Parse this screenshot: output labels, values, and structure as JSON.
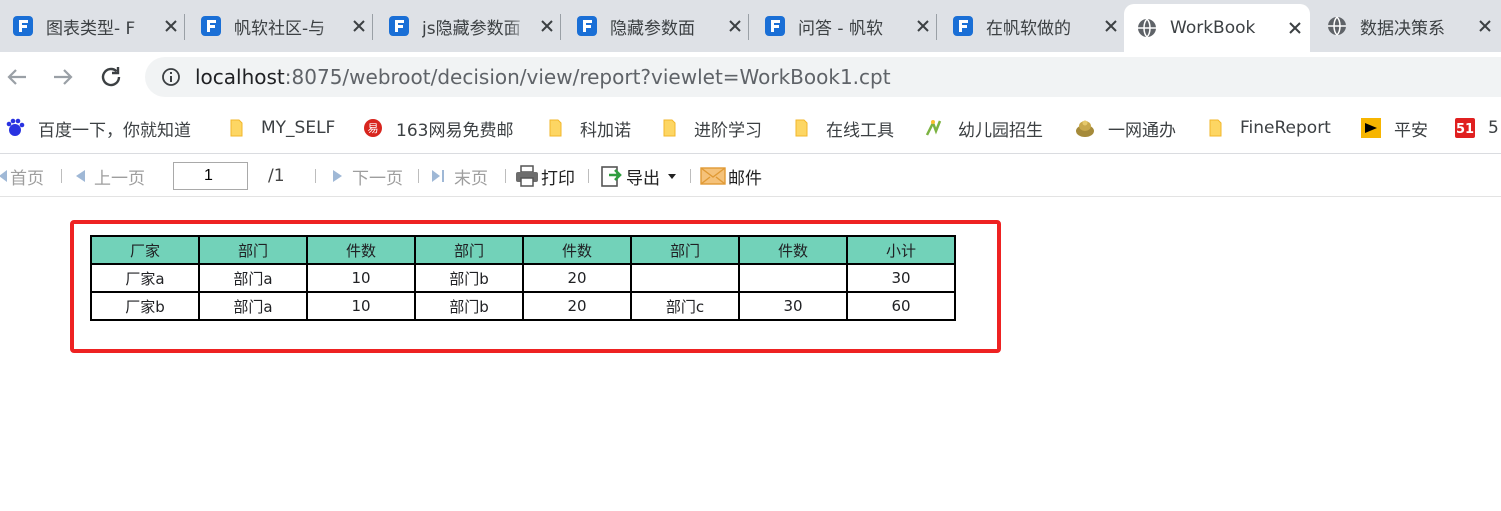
{
  "tabs": [
    {
      "title": "图表类型- F",
      "favicon": "finereport-icon"
    },
    {
      "title": "帆软社区-与",
      "favicon": "finereport-icon"
    },
    {
      "title": "js隐藏参数面",
      "favicon": "finereport-icon"
    },
    {
      "title": "隐藏参数面",
      "favicon": "finereport-icon"
    },
    {
      "title": "问答 - 帆软",
      "favicon": "finereport-icon"
    },
    {
      "title": "在帆软做的",
      "favicon": "finereport-icon"
    },
    {
      "title": "WorkBook",
      "favicon": "globe-icon",
      "active": true
    },
    {
      "title": "数据决策系",
      "favicon": "globe-icon"
    }
  ],
  "address": {
    "host": "localhost",
    "rest": ":8075/webroot/decision/view/report?viewlet=WorkBook1.cpt"
  },
  "bookmarks": [
    {
      "label": "百度一下，你就知道",
      "icon": "baidu-icon"
    },
    {
      "label": "MY_SELF",
      "icon": "folder-icon"
    },
    {
      "label": "163网易免费邮",
      "icon": "netease-icon"
    },
    {
      "label": "科加诺",
      "icon": "folder-icon"
    },
    {
      "label": "进阶学习",
      "icon": "folder-icon"
    },
    {
      "label": "在线工具",
      "icon": "folder-icon"
    },
    {
      "label": "幼儿园招生",
      "icon": "kindergarten-icon"
    },
    {
      "label": "一网通办",
      "icon": "gov-icon"
    },
    {
      "label": "FineReport",
      "icon": "folder-icon"
    },
    {
      "label": "平安",
      "icon": "pingan-icon"
    },
    {
      "label": "5",
      "icon": "51-icon"
    }
  ],
  "toolbar": {
    "first": "首页",
    "prev": "上一页",
    "page_value": "1",
    "page_total": "/1",
    "next": "下一页",
    "last": "末页",
    "print": "打印",
    "export": "导出",
    "mail": "邮件"
  },
  "report": {
    "headers": [
      "厂家",
      "部门",
      "件数",
      "部门",
      "件数",
      "部门",
      "件数",
      "小计"
    ],
    "rows": [
      [
        "厂家a",
        "部门a",
        "10",
        "部门b",
        "20",
        "",
        "",
        "30"
      ],
      [
        "厂家b",
        "部门a",
        "10",
        "部门b",
        "20",
        "部门c",
        "30",
        "60"
      ]
    ],
    "header_color": "#72d2b9",
    "highlight_color": "#ee2222"
  },
  "colors": {
    "tabstrip": "#dee1e6",
    "finereport_blue": "#1a6fd6"
  }
}
